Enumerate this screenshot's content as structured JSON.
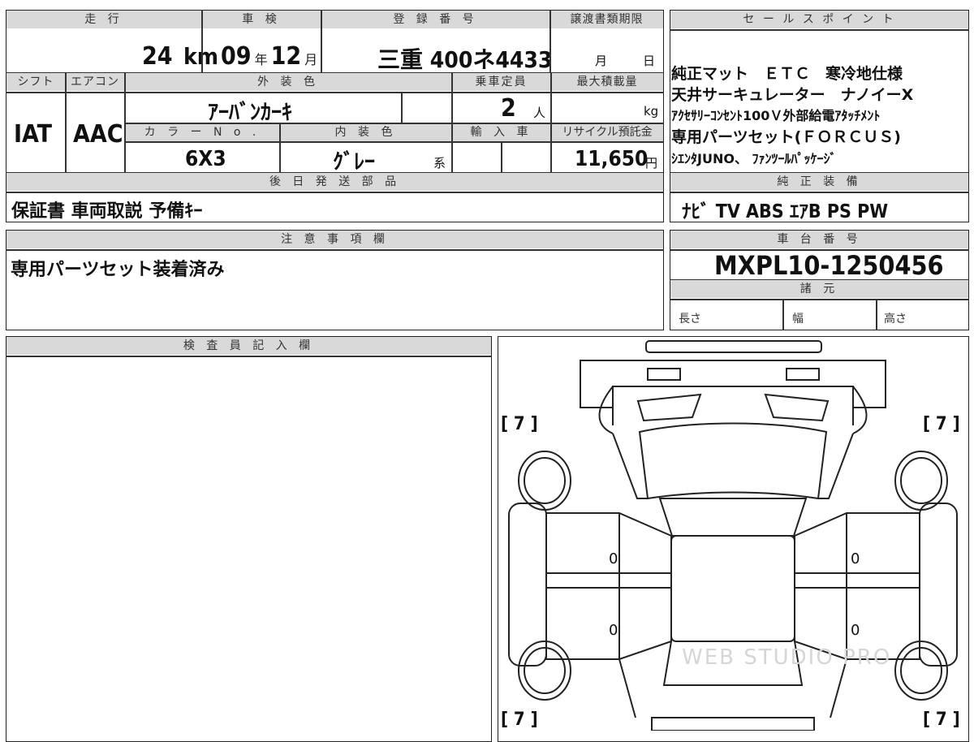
{
  "headers": {
    "mileage": "走 行",
    "inspection": "車 検",
    "registration": "登 録 番 号",
    "transfer_deadline": "譲渡書類期限",
    "sales_points": "セ ー ル ス ポ イ ン ト",
    "shift": "シフト",
    "aircon": "エアコン",
    "exterior_color": "外 装 色",
    "capacity": "乗車定員",
    "max_load": "最大積載量",
    "color_no": "カ ラ ー N o .",
    "interior_color": "内 装 色",
    "import": "輸 入 車",
    "recycle": "リサイクル預託金",
    "parts_later": "後 日 発 送 部 品",
    "oem_equipment": "純 正 装 備",
    "notes": "注 意 事 項 欄",
    "chassis": "車 台 番 号",
    "specs": "諸 元",
    "inspector": "検 査 員 記 入 欄"
  },
  "mileage": {
    "value": "24",
    "unit": "km"
  },
  "inspection": {
    "year": "09",
    "year_unit": "年",
    "month": "12",
    "month_unit": "月"
  },
  "registration": {
    "value": "三重 400ネ4433"
  },
  "transfer_deadline": {
    "month_unit": "月",
    "day_unit": "日"
  },
  "sales_points": [
    "純正マット　ＥＴＣ　寒冷地仕様",
    "天井サーキュレーター　ナノイーX",
    "ｱｸｾｻﾘｰｺﾝｾﾝﾄ100Ｖ外部給電ｱﾀｯﾁﾒﾝﾄ",
    "専用パーツセット(ＦＯＲＣＵＳ)",
    "ｼｴﾝﾀJUNO、 ﾌｧﾝﾂｰﾙﾊﾟｯｹｰｼﾞ"
  ],
  "shift": "IAT",
  "aircon": "AAC",
  "exterior_color": "ｱｰﾊﾞﾝｶｰｷ",
  "capacity": {
    "value": "2",
    "unit": "人"
  },
  "max_load": {
    "unit": "kg"
  },
  "color_no": "6X3",
  "interior_color": {
    "value": "ｸﾞﾚｰ",
    "suffix": "系"
  },
  "recycle": {
    "value": "11,650",
    "unit": "円"
  },
  "parts_later": "保証書 車両取説 予備ｷｰ",
  "oem_equipment": "ﾅﾋﾞ TV ABS ｴｱB PS PW",
  "notes": "専用パーツセット装着済み",
  "chassis": "MXPL10-1250456",
  "specs": {
    "length": "長さ",
    "width": "幅",
    "height": "高さ"
  },
  "diagram": {
    "tire_fl": "[ 7 ]",
    "tire_fr": "[ 7 ]",
    "tire_rl": "[ 7 ]",
    "tire_rr": "[ 7 ]",
    "door_l1": "0",
    "door_l2": "0",
    "door_r1": "0",
    "door_r2": "0",
    "watermark": "WEB STUDIO PRO"
  }
}
